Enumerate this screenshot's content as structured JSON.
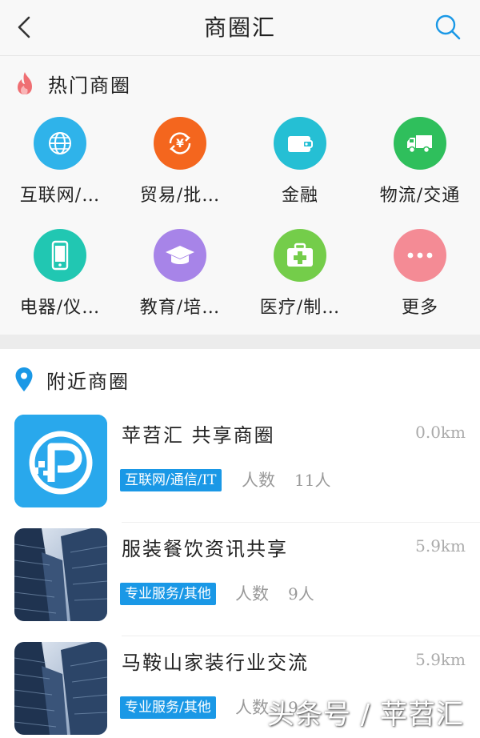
{
  "header": {
    "title": "商圈汇",
    "back_icon": "chevron-left-icon",
    "search_icon": "search-icon"
  },
  "hot": {
    "title": "热门商圈",
    "icon": "flame-icon",
    "categories": [
      {
        "label": "互联网/…",
        "icon": "globe-icon",
        "color": "#2fb3ea"
      },
      {
        "label": "贸易/批…",
        "icon": "yen-exchange-icon",
        "color": "#f4661e"
      },
      {
        "label": "金融",
        "icon": "wallet-icon",
        "color": "#25bfd4"
      },
      {
        "label": "物流/交通",
        "icon": "truck-icon",
        "color": "#2fbf5c"
      },
      {
        "label": "电器/仪…",
        "icon": "phone-icon",
        "color": "#21c7b2"
      },
      {
        "label": "教育/培…",
        "icon": "graduation-cap-icon",
        "color": "#a784e8"
      },
      {
        "label": "医疗/制…",
        "icon": "medkit-icon",
        "color": "#74cd4a"
      },
      {
        "label": "更多",
        "icon": "more-icon",
        "color": "#f48b95"
      }
    ]
  },
  "nearby": {
    "title": "附近商圈",
    "icon": "location-pin-icon",
    "count_label": "人数",
    "items": [
      {
        "name": "苹苕汇 共享商圈",
        "distance": "0.0km",
        "tag": "互联网/通信/IT",
        "count": "11人",
        "thumb": "app-logo"
      },
      {
        "name": "服装餐饮资讯共享",
        "distance": "5.9km",
        "tag": "专业服务/其他",
        "count": "9人",
        "thumb": "building-photo"
      },
      {
        "name": "马鞍山家装行业交流",
        "distance": "5.9km",
        "tag": "专业服务/其他",
        "count": "9",
        "thumb": "building-photo"
      }
    ]
  },
  "watermark": "头条号 / 苹苕汇"
}
